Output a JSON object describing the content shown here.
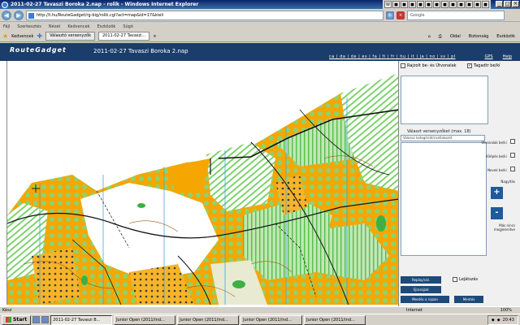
{
  "window": {
    "title": "2011-02-27 Tavaszi Boroka 2.nap - rolik - Windows Internet Explorer"
  },
  "address": {
    "url": "http://t.hu/RouteGadget/rg-big/rolik.cgi?act=map&id=17&kieli",
    "search_placeholder": "Google"
  },
  "menu": [
    "Fájl",
    "Szerkesztés",
    "Nézet",
    "Kedvencek",
    "Eszközök",
    "Súgó"
  ],
  "favbar": {
    "favorites_label": "Kedvencek",
    "tabs": [
      {
        "label": "Választó versenyzők"
      },
      {
        "label": "2011-02-27 Tavaszi..."
      }
    ],
    "tools": [
      "Oldal",
      "Biztonság",
      "Eszközök"
    ]
  },
  "app": {
    "logo": "RouteGadget",
    "event_title": "2011-02-27 Tavaszi Boroka 2.nap",
    "letters": "ca | da | de | es | fa | fi | fr | hu | it | ja | no | sv | pl",
    "gps_link": "GPS",
    "help_link": "Help"
  },
  "panel": {
    "chk_top_left": "Rajzolt be- és Útvonalak",
    "chk_top_right": "Tagadtr be/kí",
    "runner_section": "Választ versenyzőket (max. 18)",
    "select_value": "Válassz kategóriát/csatlakozót",
    "ctrl_labels": [
      "Útvonalak be/ki",
      "Kilépés be/ki",
      "Nevek be/ki",
      "Nagyítás"
    ],
    "other_label": "Más nincs megjelenítve",
    "zoom_in": "+",
    "zoom_out": "-",
    "buttons": [
      "Replay/vál.",
      "Újrarajzol",
      "Mentés a rajzon",
      "Mentés"
    ],
    "replay_label": "Lejátszás"
  },
  "status": {
    "left": "Kész",
    "zone": "Internet",
    "zoom": "100%"
  },
  "taskbar": {
    "start": "Start",
    "items": [
      {
        "label": "2011-02-27 Tavaszi B..."
      },
      {
        "label": "Junior Open (2011/ind..."
      },
      {
        "label": "Junior Open (2011/ind..."
      },
      {
        "label": "Junior Open (2011/ind..."
      },
      {
        "label": "Junior Open (2011/ind..."
      }
    ],
    "clock": "20:43"
  }
}
